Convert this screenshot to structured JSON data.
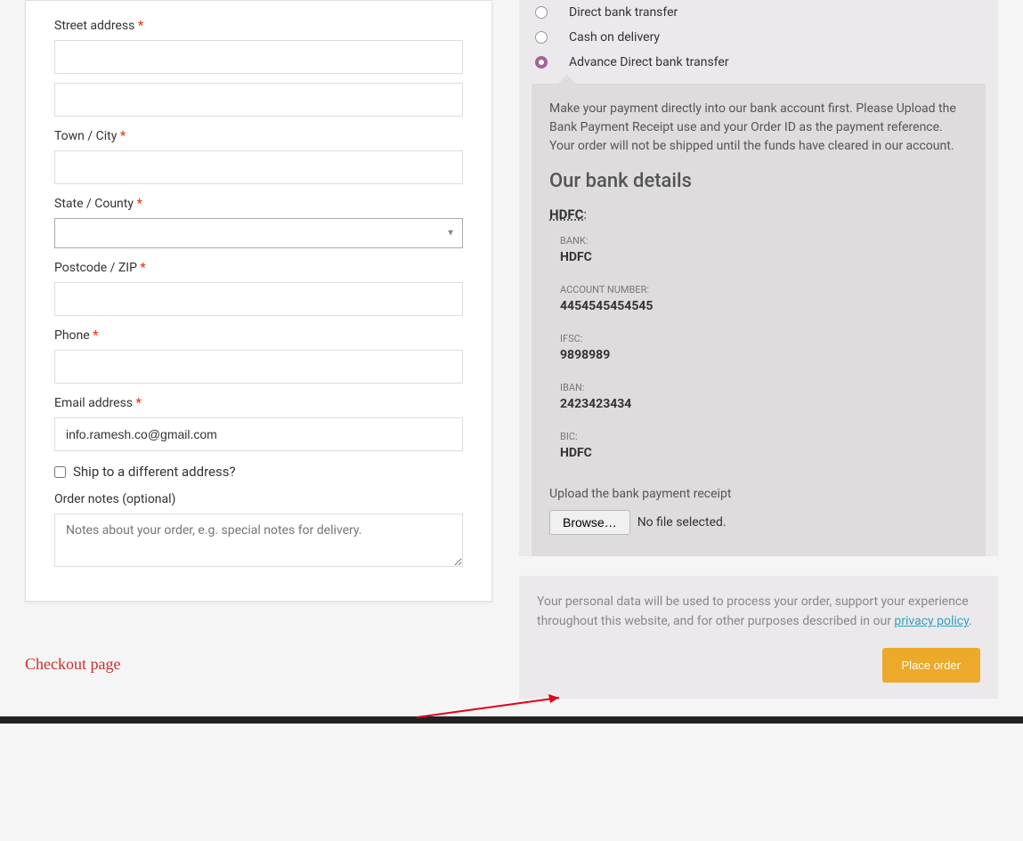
{
  "billing": {
    "street_label": "Street address",
    "town_label": "Town / City",
    "state_label": "State / County",
    "postcode_label": "Postcode / ZIP",
    "phone_label": "Phone",
    "email_label": "Email address",
    "email_value": "info.ramesh.co@gmail.com",
    "ship_diff_label": "Ship to a different address?",
    "notes_label": "Order notes (optional)",
    "notes_placeholder": "Notes about your order, e.g. special notes for delivery."
  },
  "caption": "Checkout page",
  "payment": {
    "options": [
      {
        "label": "Direct bank transfer",
        "checked": false
      },
      {
        "label": "Cash on delivery",
        "checked": false
      },
      {
        "label": "Advance Direct bank transfer",
        "checked": true
      }
    ],
    "description": "Make your payment directly into our bank account first. Please Upload the Bank Payment Receipt use and your Order ID as the payment reference. Your order will not be shipped until the funds have cleared in our account.",
    "bank_heading": "Our bank details",
    "bank_primary": "HDFC",
    "bank_fields": [
      {
        "key": "BANK:",
        "val": "HDFC"
      },
      {
        "key": "ACCOUNT NUMBER:",
        "val": "4454545454545"
      },
      {
        "key": "IFSC:",
        "val": "9898989"
      },
      {
        "key": "IBAN:",
        "val": "2423423434"
      },
      {
        "key": "BIC:",
        "val": "HDFC"
      }
    ],
    "upload_label": "Upload the bank payment receipt",
    "browse_label": "Browse…",
    "file_status": "No file selected."
  },
  "privacy": {
    "text_pre": "Your personal data will be used to process your order, support your experience throughout this website, and for other purposes described in our ",
    "link": "privacy policy",
    "text_post": "."
  },
  "place_order": "Place order"
}
